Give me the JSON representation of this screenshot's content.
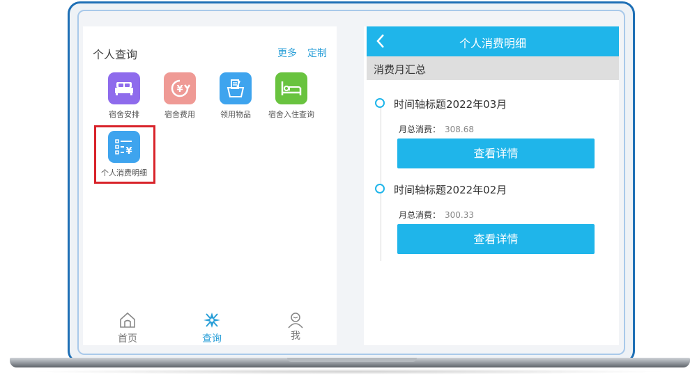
{
  "left": {
    "section_title": "个人查询",
    "more_link": "更多",
    "customize_link": "定制",
    "apps": [
      {
        "label": "宿舍安排",
        "icon": "bed-icon",
        "color": "#8e6bec"
      },
      {
        "label": "宿舍费用",
        "icon": "yuan-refresh-icon",
        "color": "#ef9a95"
      },
      {
        "label": "领用物品",
        "icon": "basket-icon",
        "color": "#3ea4ee"
      },
      {
        "label": "宿舍入住查询",
        "icon": "bed-checkin-icon",
        "color": "#69c33f"
      },
      {
        "label": "个人消费明细",
        "icon": "expense-list-icon",
        "color": "#3ea4ee"
      }
    ],
    "tabs": [
      {
        "label": "首页",
        "icon": "home-icon"
      },
      {
        "label": "查询",
        "icon": "compass-icon"
      },
      {
        "label": "我",
        "icon": "user-icon"
      }
    ]
  },
  "right": {
    "title": "个人消费明细",
    "summary_label": "消费月汇总",
    "entries": [
      {
        "title": "时间轴标题2022年03月",
        "total_label": "月总消费：",
        "total_value": "308.68",
        "button": "查看详情"
      },
      {
        "title": "时间轴标题2022年02月",
        "total_label": "月总消费：",
        "total_value": "300.33",
        "button": "查看详情"
      }
    ]
  },
  "colors": {
    "accent": "#1fb5ea",
    "highlight": "#d8232a",
    "frame": "#1e6fb5"
  }
}
